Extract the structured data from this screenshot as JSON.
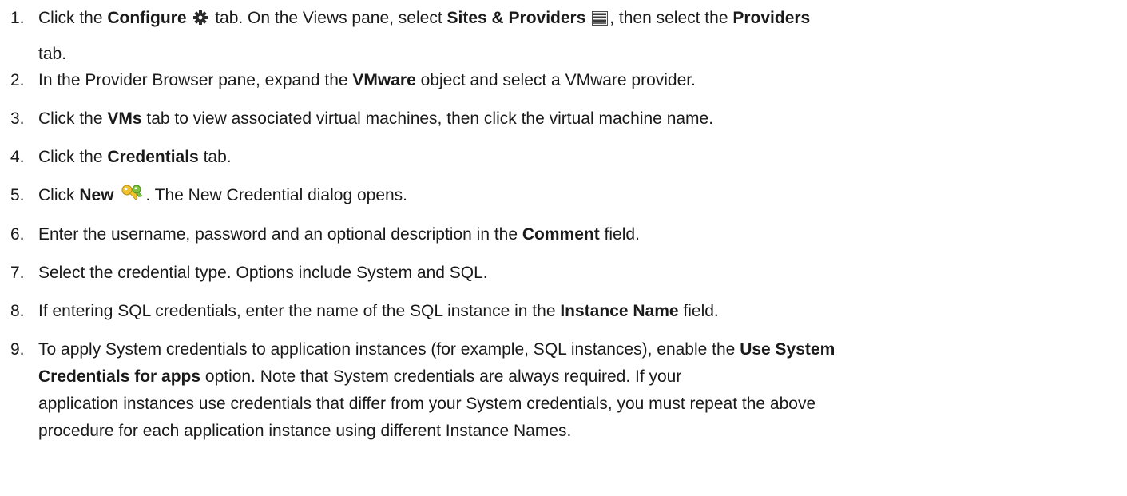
{
  "steps": [
    {
      "number": "1.",
      "parts": {
        "a": "Click the ",
        "b": "Configure",
        "c": " tab. On the Views pane, select ",
        "d": "Sites & Providers",
        "e": ", then select the ",
        "f": "Providers",
        "g": "tab."
      },
      "icons": [
        "gear-icon",
        "list-icon"
      ]
    },
    {
      "number": "2.",
      "parts": {
        "a": "In the Provider Browser pane, expand the ",
        "b": "VMware",
        "c": " object and select a VMware provider."
      }
    },
    {
      "number": "3.",
      "parts": {
        "a": "Click the ",
        "b": "VMs",
        "c": " tab to view associated virtual machines, then click the virtual machine name."
      }
    },
    {
      "number": "4.",
      "parts": {
        "a": "Click the ",
        "b": "Credentials",
        "c": " tab."
      }
    },
    {
      "number": "5.",
      "parts": {
        "a": "Click ",
        "b": "New",
        "c": ". The New Credential dialog opens."
      },
      "icons": [
        "key-icon"
      ]
    },
    {
      "number": "6.",
      "parts": {
        "a": "Enter the username, password and an optional description in the ",
        "b": "Comment",
        "c": " field."
      }
    },
    {
      "number": "7.",
      "parts": {
        "a": "Select the credential type. Options include System and SQL."
      }
    },
    {
      "number": "8.",
      "parts": {
        "a": "If entering SQL credentials, enter the name of the SQL instance in the ",
        "b": "Instance Name",
        "c": " field."
      }
    },
    {
      "number": "9.",
      "parts": {
        "a": "To apply System credentials to application instances (for example, SQL instances), enable the ",
        "b": "Use System",
        "c": "Credentials for apps",
        "d": " option. Note that System credentials are always required. If your",
        "e": "application instances use credentials that differ from your System credentials, you must repeat the above",
        "f": "procedure for each application instance using different Instance Names."
      }
    }
  ]
}
